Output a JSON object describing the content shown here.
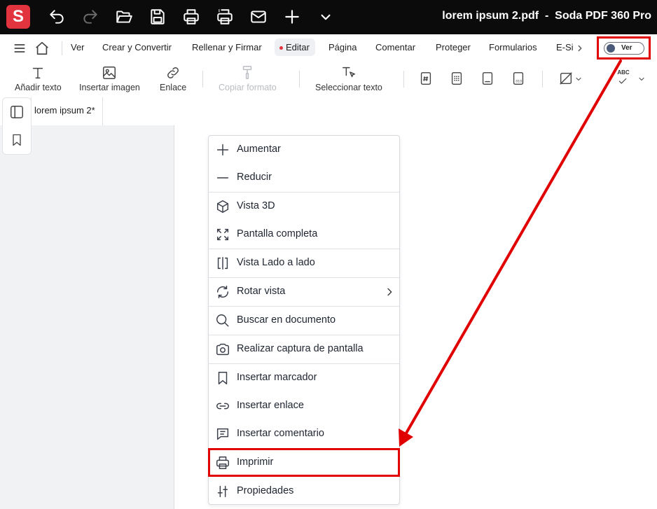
{
  "app": {
    "logo_letter": "S",
    "title": "lorem ipsum 2.pdf  -  Soda PDF 360 Pro"
  },
  "menu": {
    "items": [
      "Ver",
      "Crear y Convertir",
      "Rellenar y Firmar",
      "Editar",
      "Página",
      "Comentar",
      "Proteger",
      "Formularios",
      "E-Si"
    ],
    "active": "Editar",
    "toggle_label": "Ver"
  },
  "toolbar": {
    "add_text": "Añadir texto",
    "insert_image": "Insertar imagen",
    "link": "Enlace",
    "copy_format": "Copiar formato",
    "select_text": "Seleccionar texto",
    "spell_label": "ABC"
  },
  "tabs": {
    "document": "lorem ipsum 2*"
  },
  "context_menu": {
    "items": [
      {
        "label": "Aumentar",
        "icon": "plus-icon"
      },
      {
        "label": "Reducir",
        "icon": "minus-icon"
      },
      {
        "label": "Vista 3D",
        "icon": "cube-icon"
      },
      {
        "label": "Pantalla completa",
        "icon": "fullscreen-icon"
      },
      {
        "label": "Vista Lado a lado",
        "icon": "side-by-side-icon"
      },
      {
        "label": "Rotar vista",
        "icon": "rotate-icon"
      },
      {
        "label": "Buscar en documento",
        "icon": "search-icon"
      },
      {
        "label": "Realizar captura de pantalla",
        "icon": "camera-icon"
      },
      {
        "label": "Insertar marcador",
        "icon": "bookmark-icon"
      },
      {
        "label": "Insertar enlace",
        "icon": "link-icon"
      },
      {
        "label": "Insertar comentario",
        "icon": "comment-icon"
      },
      {
        "label": "Imprimir",
        "icon": "printer-icon"
      },
      {
        "label": "Propiedades",
        "icon": "sliders-icon"
      }
    ],
    "highlighted": "Imprimir"
  },
  "colors": {
    "brand": "#e2343f",
    "annotation": "#e00000",
    "titlebar": "#0b0b0b"
  }
}
